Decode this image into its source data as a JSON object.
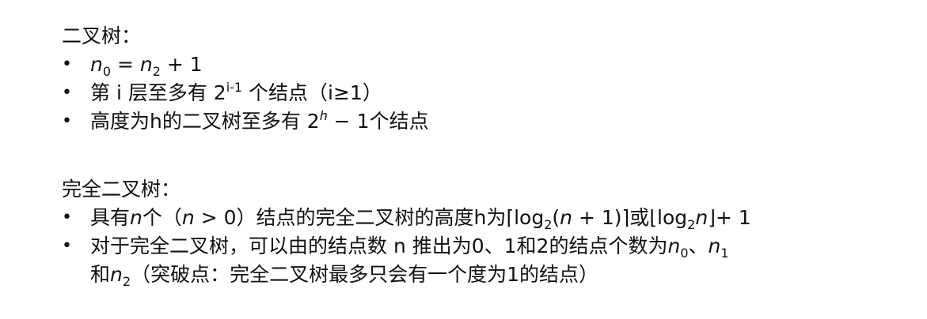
{
  "binary_tree": {
    "heading": "二叉树：",
    "items": [
      {
        "n0_a": "n",
        "n0_sub": "0",
        "eq": " = ",
        "n2_a": "n",
        "n2_sub": "2",
        "plus_one": " + 1"
      },
      {
        "prefix": "第 i 层至多有 2",
        "sup": "i-1",
        "suffix": " 个结点（i≥1）"
      },
      {
        "prefix": "高度为h的二叉树至多有 2",
        "sup": "h",
        "suffix": " − 1个结点"
      }
    ]
  },
  "complete_binary_tree": {
    "heading": "完全二叉树：",
    "items": [
      {
        "t1": "具有",
        "t2": "n",
        "t3": "个（",
        "t4": "n",
        "t5": " > 0）结点的完全二叉树的高度h为⌈log",
        "t6": "2",
        "t7": "(",
        "t8": "n",
        "t9": " + 1)⌉或⌊log",
        "t10": "2",
        "t11": "n",
        "t12": "⌋+ 1"
      },
      {
        "t1": "对于完全二叉树，可以由的结点数 n 推出为0、1和2的结点个数为",
        "t2": "n",
        "t3": "0",
        "t4": "、",
        "t5": "n",
        "t6": "1",
        "t7": "和",
        "t8": "n",
        "t9": "2",
        "t10": "（突破点：完全二叉树最多只会有一个度为1的结点）"
      }
    ]
  },
  "bullet_symbol": "•"
}
